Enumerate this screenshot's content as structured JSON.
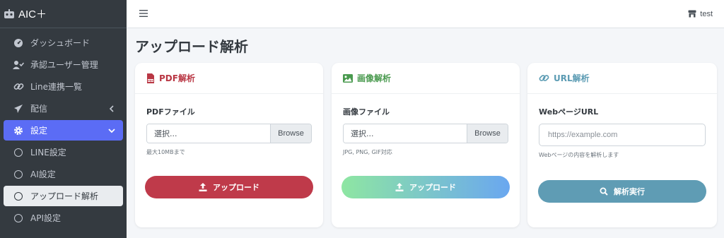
{
  "brand": {
    "title": "AIC＋",
    "icon": "robot-icon"
  },
  "topbar": {
    "menu_icon": "hamburger-icon",
    "user_label": "test",
    "user_icon": "store-icon"
  },
  "sidebar": {
    "items": [
      {
        "label": "ダッシュボード",
        "icon": "gauge-icon"
      },
      {
        "label": "承認ユーザー管理",
        "icon": "user-check-icon"
      },
      {
        "label": "Line連携一覧",
        "icon": "link-icon"
      },
      {
        "label": "配信",
        "icon": "paper-plane-icon",
        "arrow": "chevron-left-icon"
      },
      {
        "label": "設定",
        "icon": "gear-icon",
        "arrow": "chevron-down-icon"
      },
      {
        "label": "LINE設定",
        "icon": "circle-icon"
      },
      {
        "label": "AI設定",
        "icon": "circle-icon"
      },
      {
        "label": "アップロード解析",
        "icon": "circle-icon"
      },
      {
        "label": "API設定",
        "icon": "circle-icon"
      }
    ]
  },
  "page": {
    "title": "アップロード解析"
  },
  "cards": {
    "pdf": {
      "title": "PDF解析",
      "field_label": "PDFファイル",
      "file_value": "選択...",
      "browse_label": "Browse",
      "help": "最大10MBまで",
      "button_label": "アップロード",
      "color": "#b93744"
    },
    "image": {
      "title": "画像解析",
      "field_label": "画像ファイル",
      "file_value": "選択...",
      "browse_label": "Browse",
      "help": "JPG, PNG, GIF対応",
      "button_label": "アップロード",
      "color": "#4a9a4f"
    },
    "url": {
      "title": "URL解析",
      "field_label": "WebページURL",
      "placeholder": "https://example.com",
      "help": "Webページの内容を解析します",
      "button_label": "解析実行",
      "color": "#5b9bb3"
    }
  },
  "colors": {
    "sidebar_bg": "#343a40",
    "active": "#5b6cf5",
    "pdf_button": "#bf3a4a",
    "url_button": "#5f9cb4"
  }
}
